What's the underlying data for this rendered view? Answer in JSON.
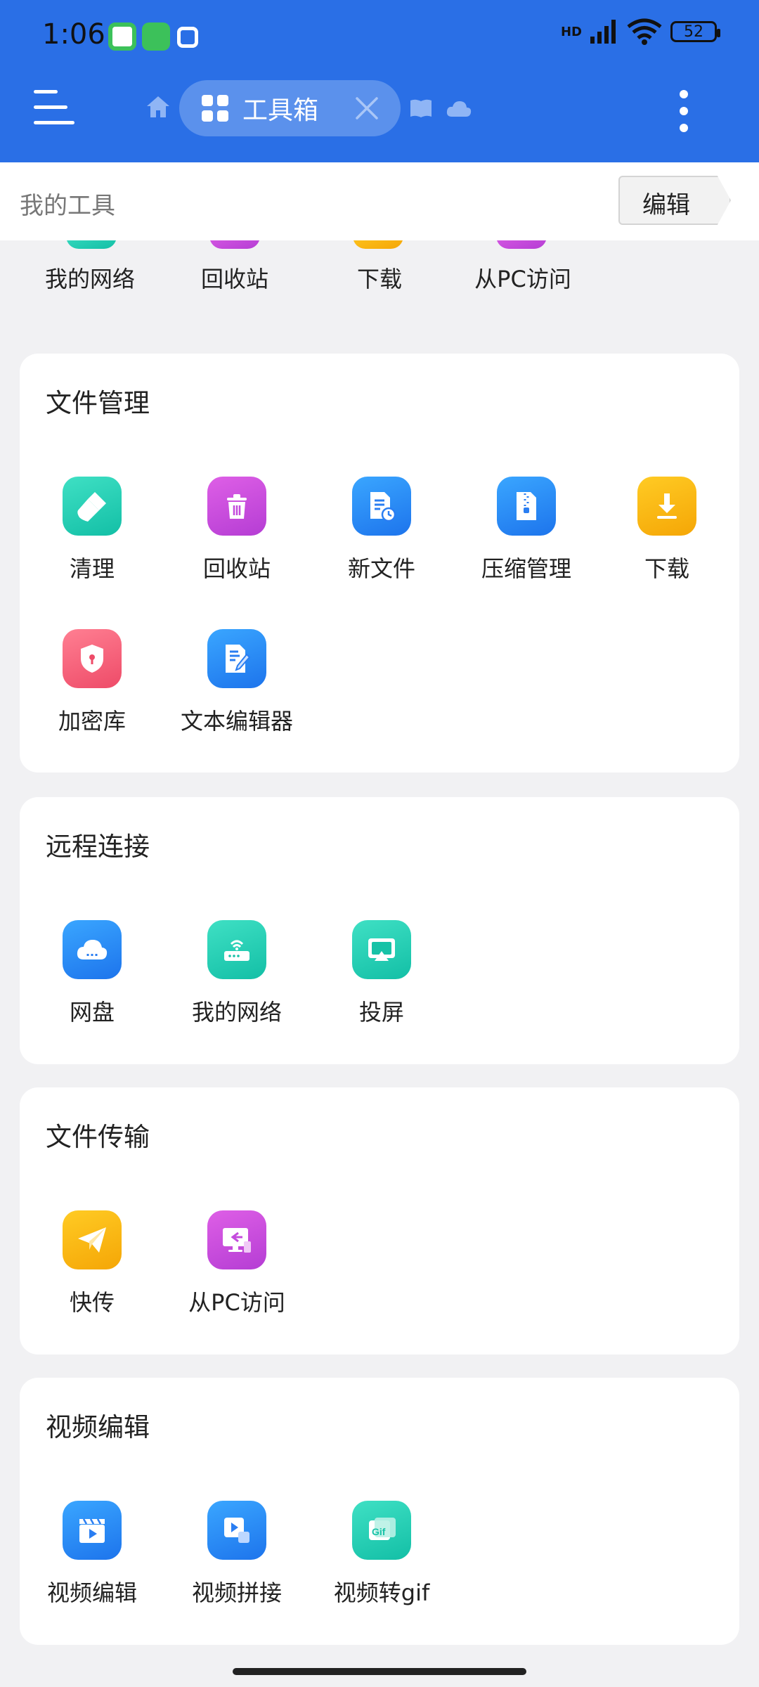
{
  "status_bar": {
    "time": "1:06",
    "battery": "52",
    "network": "HD"
  },
  "tabs": {
    "active_label": "工具箱"
  },
  "my_tools": {
    "title": "我的工具",
    "edit_label": "编辑"
  },
  "pinned": [
    "我的网络",
    "回收站",
    "下载",
    "从PC访问"
  ],
  "sections": [
    {
      "title": "文件管理",
      "items": [
        {
          "label": "清理",
          "icon": "broom-icon"
        },
        {
          "label": "回收站",
          "icon": "trash-icon"
        },
        {
          "label": "新文件",
          "icon": "new-file-icon"
        },
        {
          "label": "压缩管理",
          "icon": "zip-icon"
        },
        {
          "label": "下载",
          "icon": "download-icon"
        },
        {
          "label": "加密库",
          "icon": "shield-lock-icon"
        },
        {
          "label": "文本编辑器",
          "icon": "text-editor-icon"
        }
      ]
    },
    {
      "title": "远程连接",
      "items": [
        {
          "label": "网盘",
          "icon": "cloud-drive-icon"
        },
        {
          "label": "我的网络",
          "icon": "router-icon"
        },
        {
          "label": "投屏",
          "icon": "screen-cast-icon"
        }
      ]
    },
    {
      "title": "文件传输",
      "items": [
        {
          "label": "快传",
          "icon": "paper-plane-icon"
        },
        {
          "label": "从PC访问",
          "icon": "pc-access-icon"
        }
      ]
    },
    {
      "title": "视频编辑",
      "items": [
        {
          "label": "视频编辑",
          "icon": "clapper-icon"
        },
        {
          "label": "视频拼接",
          "icon": "video-merge-icon"
        },
        {
          "label": "视频转gif",
          "icon": "gif-icon"
        }
      ]
    }
  ],
  "colors": {
    "header_blue": "#2a6fe6",
    "teal": "#13bfa6",
    "purple": "#b53dd4",
    "blue": "#1d74ec",
    "yellow": "#f5a606",
    "red": "#ee4b68"
  }
}
